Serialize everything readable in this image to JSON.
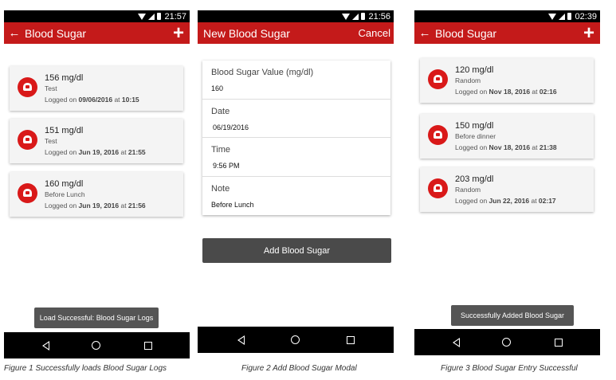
{
  "screen1": {
    "status_time": "21:57",
    "title": "Blood Sugar",
    "entries": [
      {
        "value": "156 mg/dl",
        "note": "Test",
        "logged_prefix": "Logged on ",
        "date": "09/06/2016",
        "at": " at ",
        "time": "10:15"
      },
      {
        "value": "151 mg/dl",
        "note": "Test",
        "logged_prefix": "Logged on ",
        "date": "Jun 19, 2016",
        "at": " at ",
        "time": "21:55"
      },
      {
        "value": "160 mg/dl",
        "note": "Before Lunch",
        "logged_prefix": "Logged on ",
        "date": "Jun 19, 2016",
        "at": " at ",
        "time": "21:56"
      }
    ],
    "toast": "Load Successful: Blood Sugar Logs",
    "caption": "Figure 1 Successfully loads Blood Sugar Logs"
  },
  "screen2": {
    "status_time": "21:56",
    "title": "New Blood Sugar",
    "cancel": "Cancel",
    "fields": {
      "value_label": "Blood Sugar Value (mg/dl)",
      "value": "160",
      "date_label": "Date",
      "date": "06/19/2016",
      "time_label": "Time",
      "time": "9:56 PM",
      "note_label": "Note",
      "note": "Before Lunch"
    },
    "add_button": "Add Blood Sugar",
    "caption": "Figure 2 Add Blood Sugar Modal"
  },
  "screen3": {
    "status_time": "02:39",
    "title": "Blood Sugar",
    "entries": [
      {
        "value": "120 mg/dl",
        "note": "Random",
        "logged_prefix": "Logged on ",
        "date": "Nov 18, 2016",
        "at": " at ",
        "time": "02:16"
      },
      {
        "value": "150 mg/dl",
        "note": "Before dinner",
        "logged_prefix": "Logged on ",
        "date": "Nov 18, 2016",
        "at": " at ",
        "time": "21:38"
      },
      {
        "value": "203 mg/dl",
        "note": "Random",
        "logged_prefix": "Logged on ",
        "date": "Jun 22, 2016",
        "at": " at ",
        "time": "02:17"
      }
    ],
    "toast": "Successfully Added Blood Sugar",
    "caption": "Figure 3 Blood Sugar Entry Successful"
  },
  "icons": {
    "back": "arrow-left-icon",
    "add": "plus-icon",
    "entry": "blood-drop-heart-icon",
    "nav_back": "nav-back-icon",
    "nav_home": "nav-home-icon",
    "nav_recent": "nav-recents-icon"
  },
  "colors": {
    "appbar": "#c41a1a",
    "icon": "#d91919",
    "button": "#4a4a4a",
    "toast": "#555555"
  }
}
